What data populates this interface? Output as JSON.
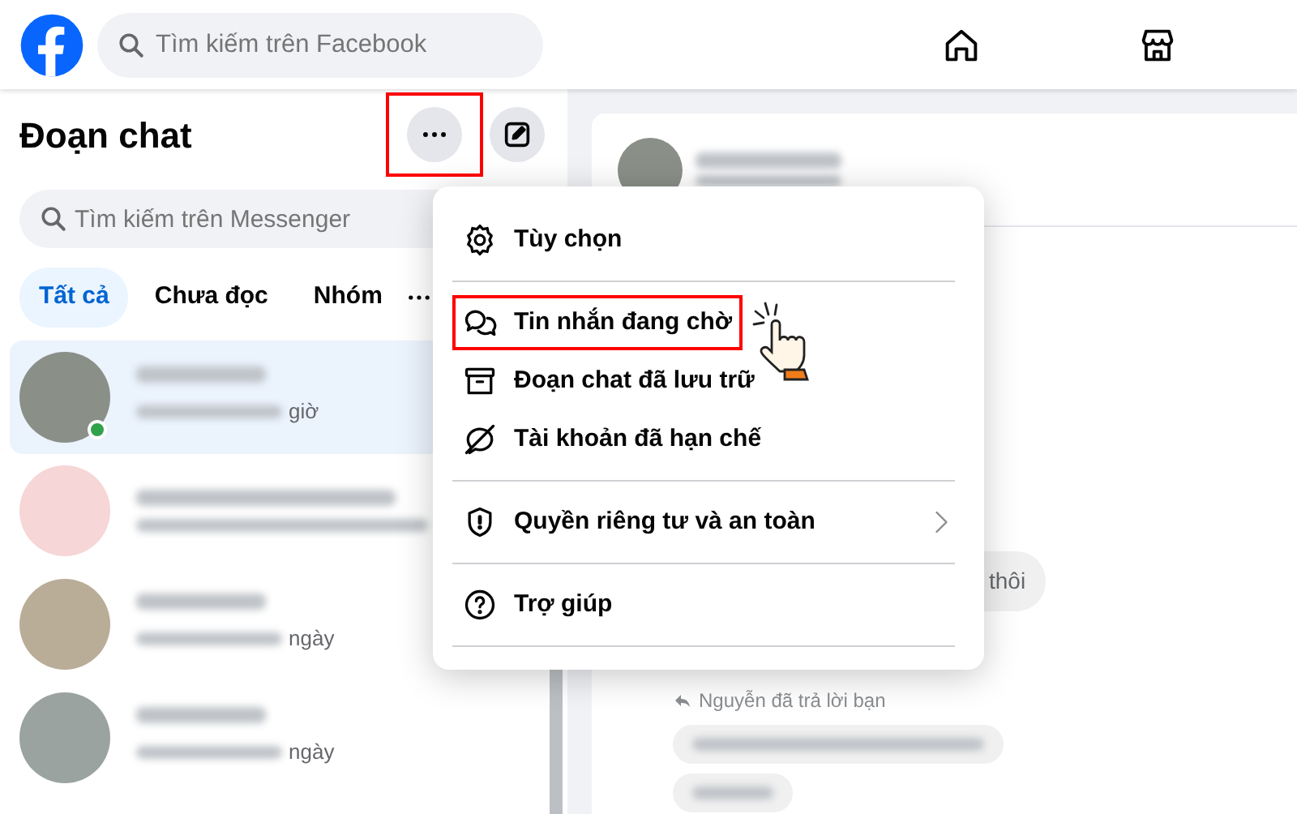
{
  "top_bar": {
    "search": {
      "placeholder": "Tìm kiếm trên Facebook"
    },
    "nav": [
      {
        "kind": "home",
        "selected": false
      },
      {
        "kind": "store",
        "selected": false
      }
    ]
  },
  "sidebar": {
    "title": "Đoạn chat",
    "more_button": {
      "highlighted": true
    },
    "search": {
      "placeholder": "Tìm kiếm trên Messenger"
    },
    "filters": [
      {
        "label": "Tất cả",
        "selected": true
      },
      {
        "label": "Chưa đọc",
        "selected": false
      },
      {
        "label": "Nhóm",
        "selected": false
      }
    ],
    "chats": [
      {
        "selected": true,
        "online": true,
        "meta": "giờ",
        "color": "#8a8f88"
      },
      {
        "selected": false,
        "online": false,
        "color": "#f6d6d6"
      },
      {
        "selected": false,
        "online": false,
        "meta": "ngày",
        "color": "#b9ad98"
      },
      {
        "selected": false,
        "online": false,
        "meta": "ngày",
        "color": "#9aa3a0"
      }
    ]
  },
  "conversation": {
    "messages": [
      {
        "kind": "received",
        "text": "thôi"
      },
      {
        "kind": "reply_label",
        "text": "Nguyễn đã trả lời bạn"
      },
      {
        "kind": "blurred"
      },
      {
        "kind": "blurred"
      }
    ]
  },
  "menu": {
    "groups": [
      {
        "items": [
          {
            "kind": "settings",
            "label": "Tùy chọn",
            "highlighted": false,
            "submenu": false
          }
        ]
      },
      {
        "items": [
          {
            "kind": "chat",
            "label": "Tin nhắn đang chờ",
            "highlighted": true,
            "submenu": false
          },
          {
            "kind": "archive",
            "label": "Đoạn chat đã lưu trữ",
            "highlighted": false,
            "submenu": false
          },
          {
            "kind": "restricted",
            "label": "Tài khoản đã hạn chế",
            "highlighted": false,
            "submenu": false
          }
        ]
      },
      {
        "items": [
          {
            "kind": "shield",
            "label": "Quyền riêng tư và an toàn",
            "highlighted": false,
            "submenu": true
          }
        ]
      },
      {
        "items": [
          {
            "kind": "help",
            "label": "Trợ giúp",
            "highlighted": false,
            "submenu": false
          }
        ]
      }
    ]
  }
}
